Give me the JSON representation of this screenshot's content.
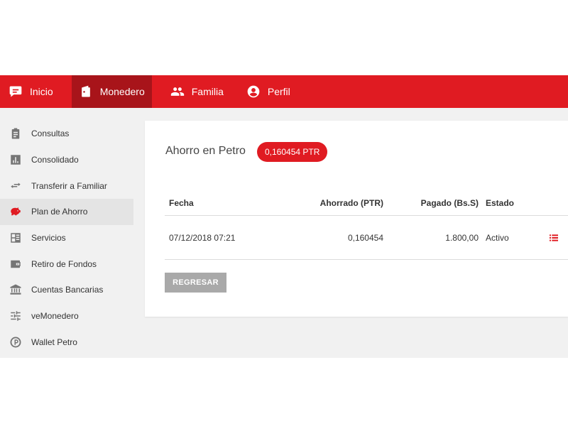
{
  "topnav": {
    "items": [
      {
        "label": "Inicio",
        "icon": "chat-icon"
      },
      {
        "label": "Monedero",
        "icon": "wallet-icon",
        "active": true
      },
      {
        "label": "Familia",
        "icon": "people-icon"
      },
      {
        "label": "Perfil",
        "icon": "account-circle-icon"
      }
    ]
  },
  "sidebar": {
    "items": [
      {
        "label": "Consultas",
        "icon": "clipboard-icon"
      },
      {
        "label": "Consolidado",
        "icon": "bar-chart-icon"
      },
      {
        "label": "Transferir a Familiar",
        "icon": "swap-arrows-icon"
      },
      {
        "label": "Plan de Ahorro",
        "icon": "piggy-bank-icon",
        "active": true
      },
      {
        "label": "Servicios",
        "icon": "services-icon"
      },
      {
        "label": "Retiro de Fondos",
        "icon": "wallet-withdraw-icon"
      },
      {
        "label": "Cuentas Bancarias",
        "icon": "bank-icon"
      },
      {
        "label": "veMonedero",
        "icon": "sliders-icon"
      },
      {
        "label": "Wallet Petro",
        "icon": "petro-coin-icon"
      }
    ]
  },
  "main": {
    "title": "Ahorro en Petro",
    "badge": "0,160454 PTR",
    "table": {
      "headers": {
        "fecha": "Fecha",
        "ahorrado": "Ahorrado (PTR)",
        "pagado": "Pagado (Bs.S)",
        "estado": "Estado"
      },
      "rows": [
        {
          "fecha": "07/12/2018 07:21",
          "ahorrado": "0,160454",
          "pagado": "1.800,00",
          "estado": "Activo"
        }
      ]
    },
    "back_button": "REGRESAR"
  },
  "colors": {
    "brand": "#e01b22",
    "brand_dark": "#a8141a",
    "button_gray": "#a9a9a9"
  }
}
